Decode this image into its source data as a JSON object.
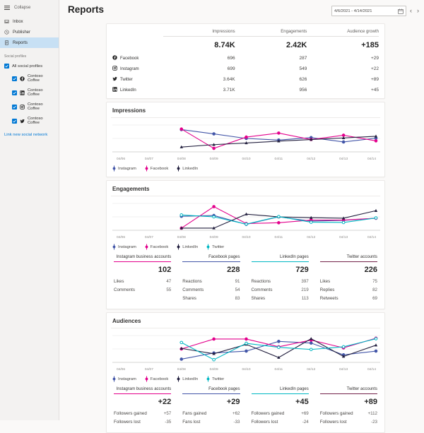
{
  "colors": {
    "accent_blue": "#0078d4",
    "instagram_line": "#4356a8",
    "facebook_line": "#e3008c",
    "linkedin_line": "#23203f",
    "twitter_line": "#00b7c3",
    "twitter_table_accent": "#73234a",
    "selected_nav_bg": "#c7e0f4"
  },
  "sidebar": {
    "collapse_label": "Collapse",
    "items": [
      {
        "label": "Inbox"
      },
      {
        "label": "Publisher"
      },
      {
        "label": "Reports"
      }
    ],
    "section_label": "Social profiles",
    "all_profiles_label": "All social profiles",
    "profiles": [
      {
        "network": "facebook",
        "label": "Contoso Coffee"
      },
      {
        "network": "linkedin",
        "label": "Contoso Coffee"
      },
      {
        "network": "instagram",
        "label": "Contoso Coffee"
      },
      {
        "network": "twitter",
        "label": "Contoso Coffee"
      }
    ],
    "link_label": "Link new social network"
  },
  "header": {
    "title": "Reports",
    "date_range": "4/6/2021 - 4/14/2021"
  },
  "summary": {
    "columns": [
      "Impressions",
      "Engagements",
      "Audience growth"
    ],
    "totals": [
      "8.74K",
      "2.42K",
      "+185"
    ],
    "rows": [
      {
        "network": "Facebook",
        "impressions": "696",
        "engagements": "287",
        "growth": "+29"
      },
      {
        "network": "Instagram",
        "impressions": "699",
        "engagements": "549",
        "growth": "+22"
      },
      {
        "network": "Twitter",
        "impressions": "3.64K",
        "engagements": "626",
        "growth": "+89"
      },
      {
        "network": "LinkedIn",
        "impressions": "3.71K",
        "engagements": "956",
        "growth": "+45"
      }
    ]
  },
  "sections": {
    "impressions_title": "Impressions",
    "engagements_title": "Engagements",
    "audiences_title": "Audiences"
  },
  "chart_data": [
    {
      "id": "impressions",
      "type": "line",
      "title": "Impressions",
      "x_ticks": [
        "04/06",
        "04/07",
        "04/08",
        "04/09",
        "04/10",
        "04/11",
        "04/12",
        "04/13",
        "04/14"
      ],
      "x_start_index": 2,
      "ylim": [
        0,
        100
      ],
      "grid": true,
      "legend_position": "bottom",
      "series": [
        {
          "name": "Instagram",
          "color": "#4356a8",
          "marker": "circle",
          "values": [
            83,
            67,
            50,
            44,
            53,
            37,
            51
          ]
        },
        {
          "name": "Facebook",
          "color": "#e3008c",
          "marker": "circle",
          "values": [
            85,
            13,
            55,
            70,
            46,
            62,
            41
          ]
        },
        {
          "name": "LinkedIn",
          "color": "#23203f",
          "marker": "triangle",
          "values": [
            18,
            27,
            33,
            40,
            46,
            52,
            58
          ]
        }
      ]
    },
    {
      "id": "engagements",
      "type": "line",
      "title": "Engagements",
      "x_ticks": [
        "04/06",
        "04/07",
        "04/08",
        "04/09",
        "04/10",
        "04/11",
        "04/12",
        "04/13",
        "04/14"
      ],
      "x_start_index": 2,
      "ylim": [
        0,
        100
      ],
      "grid": true,
      "legend_position": "bottom",
      "series": [
        {
          "name": "Instagram",
          "color": "#4356a8",
          "marker": "circle",
          "values": [
            52,
            55,
            22,
            50,
            34,
            37,
            45
          ]
        },
        {
          "name": "Facebook",
          "color": "#e3008c",
          "marker": "circle",
          "values": [
            8,
            88,
            25,
            28,
            38,
            38,
            45
          ]
        },
        {
          "name": "LinkedIn",
          "color": "#23203f",
          "marker": "triangle",
          "values": [
            8,
            8,
            60,
            50,
            47,
            45,
            73
          ]
        },
        {
          "name": "Twitter",
          "color": "#00b7c3",
          "marker": "circle-open",
          "values": [
            57,
            50,
            23,
            51,
            30,
            29,
            46
          ]
        }
      ]
    },
    {
      "id": "audiences",
      "type": "line",
      "title": "Audiences",
      "x_ticks": [
        "04/06",
        "04/07",
        "04/08",
        "04/09",
        "04/10",
        "04/11",
        "04/12",
        "04/13",
        "04/14"
      ],
      "x_start_index": 2,
      "ylim": [
        0,
        100
      ],
      "grid": true,
      "legend_position": "bottom",
      "series": [
        {
          "name": "Instagram",
          "color": "#4356a8",
          "marker": "circle",
          "values": [
            12,
            35,
            42,
            78,
            72,
            28,
            42
          ]
        },
        {
          "name": "Facebook",
          "color": "#e3008c",
          "marker": "circle",
          "values": [
            50,
            87,
            87,
            58,
            83,
            54,
            90
          ]
        },
        {
          "name": "LinkedIn",
          "color": "#23203f",
          "marker": "triangle",
          "values": [
            52,
            32,
            67,
            18,
            88,
            22,
            64
          ]
        },
        {
          "name": "Twitter",
          "color": "#00b7c3",
          "marker": "circle-open",
          "values": [
            74,
            10,
            71,
            56,
            48,
            58,
            88
          ]
        }
      ]
    }
  ],
  "engagement_metrics": {
    "columns": [
      {
        "header": "Instagram business accounts",
        "accent": "#e3008c",
        "total": "102",
        "rows": [
          [
            "Likes",
            "47"
          ],
          [
            "Comments",
            "55"
          ]
        ]
      },
      {
        "header": "Facebook pages",
        "accent": "#4356a8",
        "total": "228",
        "rows": [
          [
            "Reactions",
            "91"
          ],
          [
            "Comments",
            "54"
          ],
          [
            "Shares",
            "83"
          ]
        ]
      },
      {
        "header": "LinkedIn pages",
        "accent": "#00b7c3",
        "total": "729",
        "rows": [
          [
            "Reactions",
            "397"
          ],
          [
            "Comments",
            "219"
          ],
          [
            "Shares",
            "113"
          ]
        ]
      },
      {
        "header": "Twitter accounts",
        "accent": "#73234a",
        "total": "226",
        "rows": [
          [
            "Likes",
            "75"
          ],
          [
            "Replies",
            "82"
          ],
          [
            "Retweets",
            "69"
          ]
        ]
      }
    ]
  },
  "audience_metrics": {
    "columns": [
      {
        "header": "Instagram business accounts",
        "accent": "#e3008c",
        "total": "+22",
        "rows": [
          [
            "Followers gained",
            "+57"
          ],
          [
            "Followers lost",
            "-35"
          ]
        ]
      },
      {
        "header": "Facebook pages",
        "accent": "#4356a8",
        "total": "+29",
        "rows": [
          [
            "Fans gained",
            "+62"
          ],
          [
            "Fans lost",
            "-33"
          ]
        ]
      },
      {
        "header": "LinkedIn pages",
        "accent": "#00b7c3",
        "total": "+45",
        "rows": [
          [
            "Followers gained",
            "+69"
          ],
          [
            "Followers lost",
            "-24"
          ]
        ]
      },
      {
        "header": "Twitter accounts",
        "accent": "#73234a",
        "total": "+89",
        "rows": [
          [
            "Followers gained",
            "+112"
          ],
          [
            "Followers lost",
            "-23"
          ]
        ]
      }
    ]
  }
}
